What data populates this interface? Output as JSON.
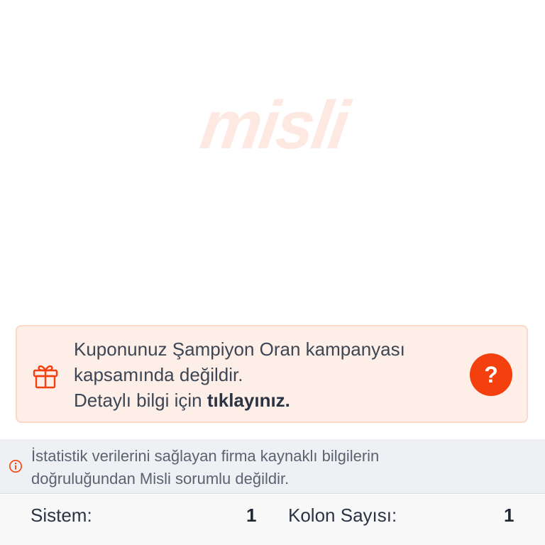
{
  "brand": {
    "watermark": "misli",
    "accent_color": "#f4400f"
  },
  "promo": {
    "line1": "Kuponunuz Şampiyon Oran kampanyası",
    "line2": "kapsamında değildir.",
    "line3_prefix": "Detaylı bilgi için ",
    "line3_link": "tıklayınız.",
    "icon": "gift-icon",
    "help_button": "?"
  },
  "notice": {
    "icon": "info-icon",
    "line1": "İstatistik verilerini sağlayan firma kaynaklı bilgilerin",
    "line2": "doğruluğundan Misli sorumlu değildir."
  },
  "summary": {
    "system_label": "Sistem:",
    "system_value": "1",
    "columns_label": "Kolon Sayısı:",
    "columns_value": "1"
  }
}
